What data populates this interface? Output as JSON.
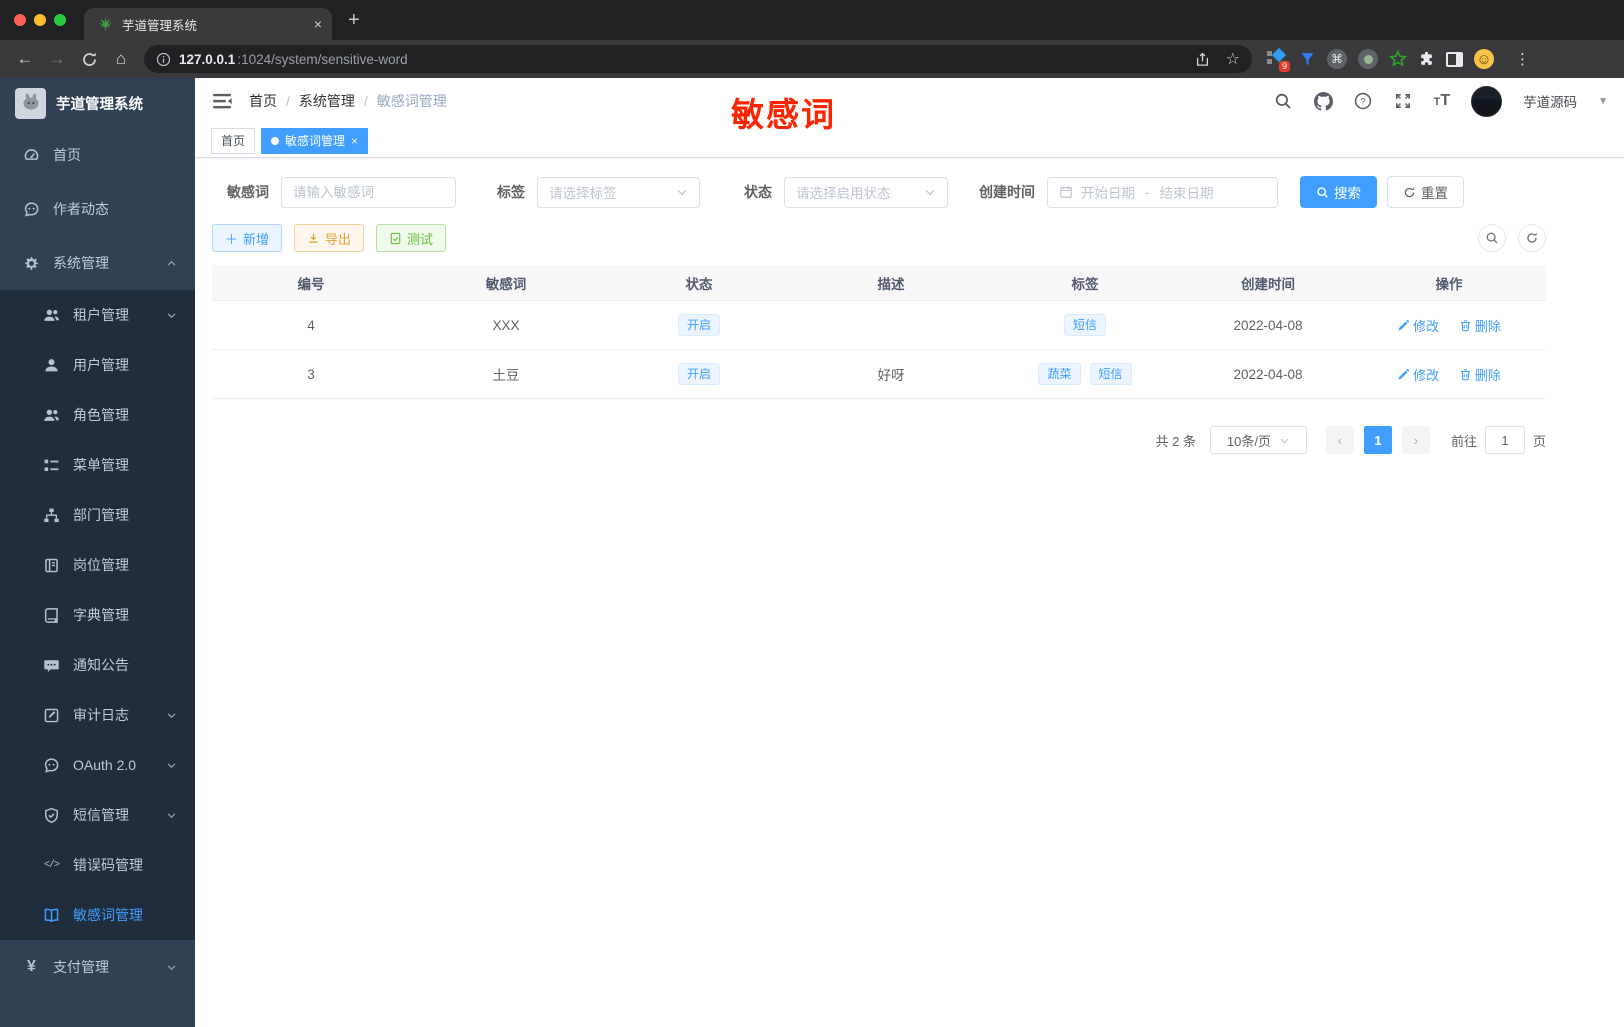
{
  "browser": {
    "tab_title": "芋道管理系统",
    "new_tab": "+",
    "close_tab": "×",
    "url_host": "127.0.0.1",
    "url_rest": ":1024/system/sensitive-word",
    "extension_badge": "9",
    "cmd_glyph": "⌘",
    "menu_glyph": "⋮"
  },
  "sidebar": {
    "logo_title": "芋道管理系统",
    "items": [
      {
        "label": "首页"
      },
      {
        "label": "作者动态"
      },
      {
        "label": "系统管理"
      },
      {
        "label": "租户管理"
      },
      {
        "label": "用户管理"
      },
      {
        "label": "角色管理"
      },
      {
        "label": "菜单管理"
      },
      {
        "label": "部门管理"
      },
      {
        "label": "岗位管理"
      },
      {
        "label": "字典管理"
      },
      {
        "label": "通知公告"
      },
      {
        "label": "审计日志"
      },
      {
        "label": "OAuth 2.0"
      },
      {
        "label": "短信管理"
      },
      {
        "label": "错误码管理"
      },
      {
        "label": "敏感词管理"
      },
      {
        "label": "支付管理"
      }
    ],
    "errcode_glyph": "</>",
    "pay_glyph": "¥"
  },
  "navbar": {
    "breadcrumb": [
      "首页",
      "系统管理",
      "敏感词管理"
    ],
    "separator": "/",
    "annotation": "敏感词",
    "user_name": "芋道源码"
  },
  "tags_view": {
    "tabs": [
      {
        "label": "首页"
      },
      {
        "label": "敏感词管理",
        "close": "×"
      }
    ]
  },
  "filters": {
    "keyword_label": "敏感词",
    "keyword_placeholder": "请输入敏感词",
    "tag_label": "标签",
    "tag_placeholder": "请选择标签",
    "status_label": "状态",
    "status_placeholder": "请选择启用状态",
    "date_label": "创建时间",
    "date_start_placeholder": "开始日期",
    "date_separator": "-",
    "date_end_placeholder": "结束日期",
    "search_label": "搜索",
    "reset_label": "重置"
  },
  "toolbar": {
    "add_label": "新增",
    "export_label": "导出",
    "test_label": "测试"
  },
  "table": {
    "columns": [
      "编号",
      "敏感词",
      "状态",
      "描述",
      "标签",
      "创建时间",
      "操作"
    ],
    "edit_label": "修改",
    "delete_label": "删除",
    "rows": [
      {
        "id": "4",
        "word": "XXX",
        "status": "开启",
        "desc": "",
        "tags": [
          "短信"
        ],
        "created": "2022-04-08"
      },
      {
        "id": "3",
        "word": "土豆",
        "status": "开启",
        "desc": "好呀",
        "tags": [
          "蔬菜",
          "短信"
        ],
        "created": "2022-04-08"
      }
    ]
  },
  "pagination": {
    "total": "共 2 条",
    "page_size": "10条/页",
    "prev": "‹",
    "next": "›",
    "current": "1",
    "goto_label": "前往",
    "goto_value": "1",
    "unit_label": "页"
  },
  "colors": {
    "primary": "#409eff",
    "sidebar_bg": "#304156",
    "submenu_bg": "#1f2d3d",
    "annotation_red": "#ff2400",
    "warning": "#e6a23c",
    "success": "#67c23a"
  }
}
